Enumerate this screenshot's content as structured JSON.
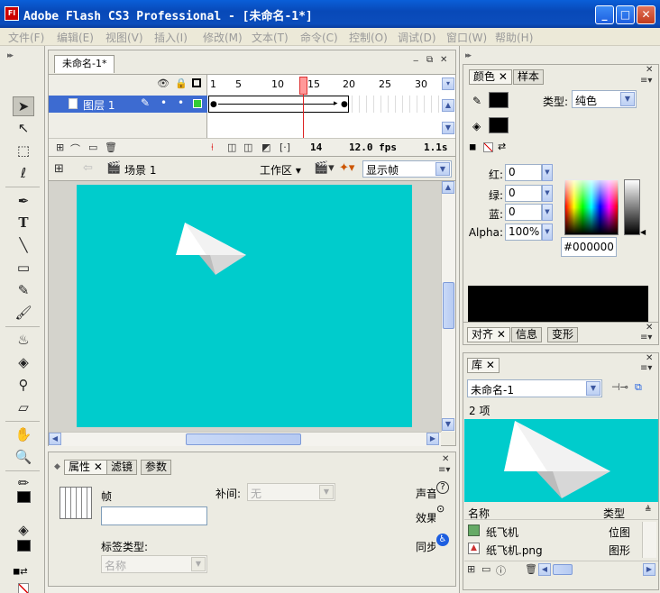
{
  "window": {
    "title": "Adobe Flash CS3 Professional - [未命名-1*]",
    "app_icon": "Fl",
    "minimize_glyph": "_",
    "maximize_glyph": "□",
    "close_glyph": "✕"
  },
  "menu": [
    "文件(F)",
    "编辑(E)",
    "视图(V)",
    "插入(I)",
    "修改(M)",
    "文本(T)",
    "命令(C)",
    "控制(O)",
    "调试(D)",
    "窗口(W)",
    "帮助(H)"
  ],
  "document": {
    "tab_label": "未命名-1*",
    "layer_name": "图层 1",
    "frame_numbers": [
      "1",
      "5",
      "10",
      "15",
      "20",
      "25",
      "30"
    ],
    "status": {
      "current_frame": "14",
      "frame_rate": "12.0 fps",
      "elapsed": "1.1s"
    },
    "scene_label": "场景 1",
    "workspace_label": "工作区",
    "view_option": "显示帧",
    "stage_color": "#00cccc"
  },
  "properties": {
    "tabs": [
      "属性",
      "滤镜",
      "参数"
    ],
    "frame_label": "帧",
    "frame_name_value": "",
    "tween_label": "补间:",
    "tween_value": "无",
    "label_type_label": "标签类型:",
    "label_type_value": "名称",
    "sound_label": "声音",
    "effect_label": "效果",
    "sync_label": "同步"
  },
  "color_panel": {
    "tabs": [
      "颜色",
      "样本"
    ],
    "type_label": "类型:",
    "type_value": "纯色",
    "red_label": "红:",
    "red_value": "0",
    "green_label": "绿:",
    "green_value": "0",
    "blue_label": "蓝:",
    "blue_value": "0",
    "alpha_label": "Alpha:",
    "alpha_value": "100%",
    "hex_value": "#000000",
    "current_color": "#000000"
  },
  "align_panel": {
    "tabs": [
      "对齐",
      "信息",
      "变形"
    ]
  },
  "library": {
    "tab": "库",
    "document_value": "未命名-1",
    "item_count": "2 项",
    "col_name": "名称",
    "col_type": "类型",
    "items": [
      {
        "name": "纸飞机",
        "type": "位图"
      },
      {
        "name": "纸飞机.png",
        "type": "图形"
      }
    ]
  }
}
